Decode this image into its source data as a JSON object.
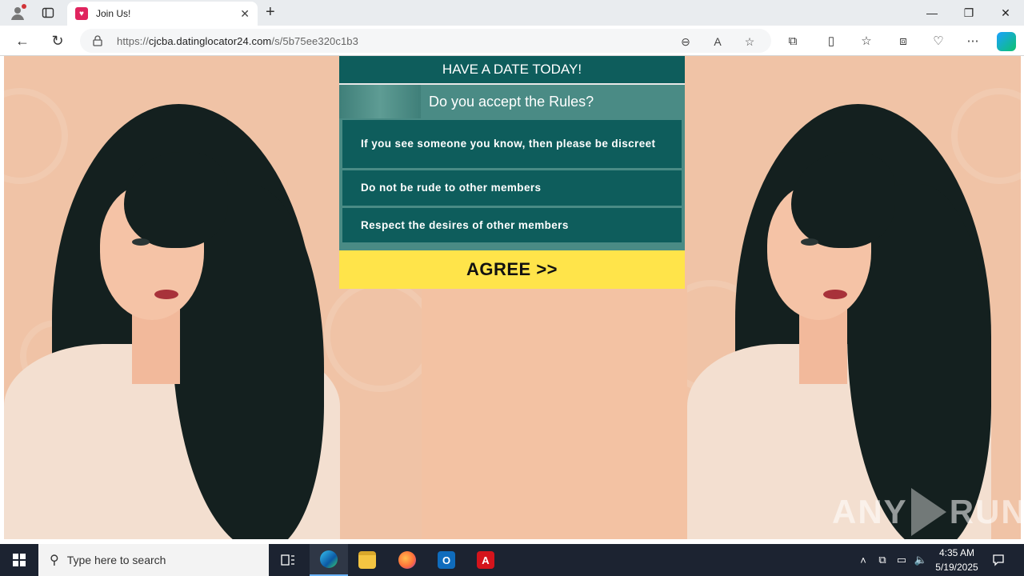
{
  "browser": {
    "tab_title": "Join Us!",
    "new_tab_symbol": "+",
    "tab_close_symbol": "✕",
    "url_prefix": "https://",
    "url_host": "cjcba.datinglocator24.com",
    "url_path": "/s/5b75ee320c1b3",
    "window_controls": {
      "minimize": "—",
      "restore": "❐",
      "close": "✕"
    },
    "icons": [
      "profile-icon",
      "tab-actions-icon",
      "back-icon",
      "refresh-icon",
      "lock-icon",
      "zoom-icon",
      "read-aloud-icon",
      "favorite-star-icon",
      "extensions-icon",
      "split-screen-icon",
      "favorites-icon",
      "collections-icon",
      "browser-essentials-icon",
      "more-icon",
      "copilot-icon"
    ]
  },
  "page": {
    "header": "HAVE A DATE TODAY!",
    "question": "Do you accept the Rules?",
    "rules": [
      "If you see someone you know, then please be discreet",
      "Do not be rude to other members",
      "Respect the desires of other members"
    ],
    "agree_label": "AGREE >>",
    "colors": {
      "teal_dark": "#0e5d5c",
      "teal_mid": "#4a8b85",
      "button_yellow": "#ffe44a",
      "background_peach": "#f0c3a6"
    }
  },
  "watermark": {
    "left": "ANY",
    "right": "RUN"
  },
  "taskbar": {
    "search_placeholder": "Type here to search",
    "time": "4:35 AM",
    "date": "5/19/2025",
    "apps": [
      "task-view-icon",
      "edge-icon",
      "file-explorer-icon",
      "firefox-icon",
      "outlook-icon",
      "acrobat-icon"
    ]
  }
}
